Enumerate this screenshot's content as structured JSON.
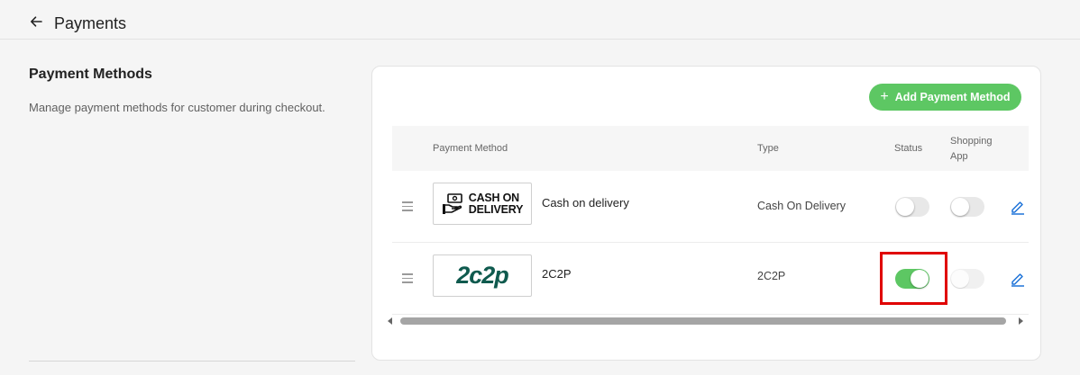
{
  "header": {
    "title": "Payments",
    "back_icon": "arrow-left-icon"
  },
  "sidebar": {
    "title": "Payment Methods",
    "description": "Manage payment methods for customer during checkout."
  },
  "toolbar": {
    "add_label": "Add Payment Method",
    "add_icon": "plus-icon",
    "accent": "#5dc763"
  },
  "table": {
    "columns": [
      "Payment Method",
      "Type",
      "Status",
      "Shopping App"
    ],
    "rows": [
      {
        "logo_text": "CASH ON DELIVERY",
        "logo_line1": "CASH ON",
        "logo_line2": "DELIVERY",
        "name": "Cash on delivery",
        "type": "Cash On Delivery",
        "status": "off",
        "shopping_app": "off"
      },
      {
        "logo_text": "2c2p",
        "name": "2C2P",
        "type": "2C2P",
        "status": "on",
        "shopping_app": "disabled"
      }
    ]
  },
  "colors": {
    "toggle_on": "#5dc763",
    "highlight": "#e00000",
    "edit_icon": "#1e73d8"
  }
}
